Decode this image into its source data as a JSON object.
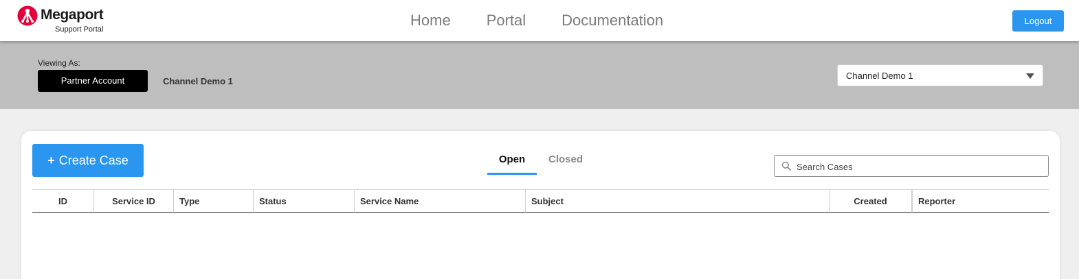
{
  "header": {
    "brand_name": "Megaport",
    "brand_sub": "Support Portal",
    "nav": [
      "Home",
      "Portal",
      "Documentation"
    ],
    "logout_label": "Logout"
  },
  "account": {
    "viewing_label": "Viewing As:",
    "badge": "Partner Account",
    "name": "Channel Demo 1",
    "selected": "Channel Demo 1"
  },
  "cases": {
    "create_label": "Create Case",
    "tabs": [
      "Open",
      "Closed"
    ],
    "active_tab": "Open",
    "search_placeholder": "Search Cases",
    "columns": [
      "ID",
      "Service ID",
      "Type",
      "Status",
      "Service Name",
      "Subject",
      "Created",
      "Reporter"
    ],
    "rows": []
  },
  "colors": {
    "accent": "#2b96f0",
    "brand": "#e4003a",
    "account_bar": "#bebebe"
  }
}
